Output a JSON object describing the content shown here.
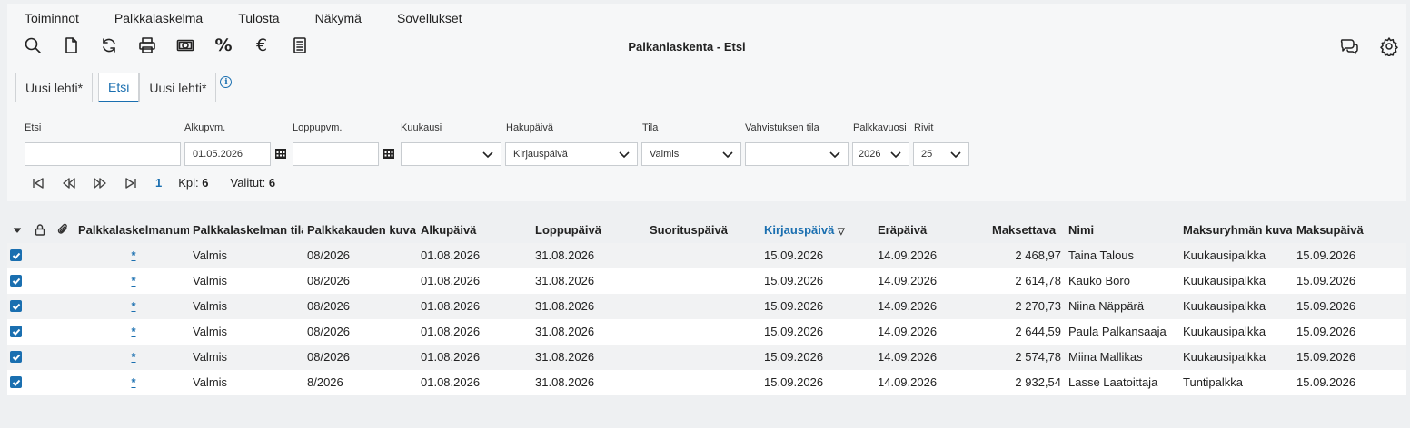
{
  "menu": [
    "Toiminnot",
    "Palkkalaskelma",
    "Tulosta",
    "Näkymä",
    "Sovellukset"
  ],
  "toolbar_icons": [
    "search-icon",
    "new-document-icon",
    "refresh-icon",
    "print-icon",
    "money-icon",
    "percent-icon",
    "euro-icon",
    "report-icon"
  ],
  "title": "Palkanlaskenta - Etsi",
  "tabs": [
    "Uusi lehti*",
    "Etsi",
    "Uusi lehti*"
  ],
  "active_tab": 1,
  "filters": {
    "etsi": {
      "label": "Etsi",
      "value": ""
    },
    "alkupvm": {
      "label": "Alkupvm.",
      "value": "01.05.2026"
    },
    "loppupvm": {
      "label": "Loppupvm.",
      "value": ""
    },
    "kuukausi": {
      "label": "Kuukausi",
      "value": ""
    },
    "hakupaiva": {
      "label": "Hakupäivä",
      "value": "Kirjauspäivä"
    },
    "tila": {
      "label": "Tila",
      "value": "Valmis"
    },
    "vahvistuksen_tila": {
      "label": "Vahvistuksen tila",
      "value": ""
    },
    "palkkavuosi": {
      "label": "Palkkavuosi",
      "value": "2026"
    },
    "rivit": {
      "label": "Rivit",
      "value": "25"
    }
  },
  "pager": {
    "page": "1",
    "kpl_label": "Kpl:",
    "kpl": "6",
    "valitut_label": "Valitut:",
    "valitut": "6"
  },
  "columns": [
    "Palkkalaskelmanumero",
    "Palkkalaskelman tila",
    "Palkkakauden kuvaus",
    "Alkupäivä",
    "Loppupäivä",
    "Suorituspäivä",
    "Kirjauspäivä",
    "Eräpäivä",
    "Maksettava",
    "Nimi",
    "Maksuryhmän kuvaus",
    "Maksupäivä"
  ],
  "sorted_column": "Kirjauspäivä",
  "rows": [
    {
      "nro": "*",
      "tila": "Valmis",
      "kausi": "08/2026",
      "alku": "01.08.2026",
      "loppu": "31.08.2026",
      "suoritus": "",
      "kirjaus": "15.09.2026",
      "era": "14.09.2026",
      "maksettava": "2 468,97",
      "nimi": "Taina Talous",
      "ryhma": "Kuukausipalkka",
      "maksu": "15.09.2026"
    },
    {
      "nro": "*",
      "tila": "Valmis",
      "kausi": "08/2026",
      "alku": "01.08.2026",
      "loppu": "31.08.2026",
      "suoritus": "",
      "kirjaus": "15.09.2026",
      "era": "14.09.2026",
      "maksettava": "2 614,78",
      "nimi": "Kauko Boro",
      "ryhma": "Kuukausipalkka",
      "maksu": "15.09.2026"
    },
    {
      "nro": "*",
      "tila": "Valmis",
      "kausi": "08/2026",
      "alku": "01.08.2026",
      "loppu": "31.08.2026",
      "suoritus": "",
      "kirjaus": "15.09.2026",
      "era": "14.09.2026",
      "maksettava": "2 270,73",
      "nimi": "Niina Näppärä",
      "ryhma": "Kuukausipalkka",
      "maksu": "15.09.2026"
    },
    {
      "nro": "*",
      "tila": "Valmis",
      "kausi": "08/2026",
      "alku": "01.08.2026",
      "loppu": "31.08.2026",
      "suoritus": "",
      "kirjaus": "15.09.2026",
      "era": "14.09.2026",
      "maksettava": "2 644,59",
      "nimi": "Paula Palkansaaja",
      "ryhma": "Kuukausipalkka",
      "maksu": "15.09.2026"
    },
    {
      "nro": "*",
      "tila": "Valmis",
      "kausi": "08/2026",
      "alku": "01.08.2026",
      "loppu": "31.08.2026",
      "suoritus": "",
      "kirjaus": "15.09.2026",
      "era": "14.09.2026",
      "maksettava": "2 574,78",
      "nimi": "Miina Mallikas",
      "ryhma": "Kuukausipalkka",
      "maksu": "15.09.2026"
    },
    {
      "nro": "*",
      "tila": "Valmis",
      "kausi": "8/2026",
      "alku": "01.08.2026",
      "loppu": "31.08.2026",
      "suoritus": "",
      "kirjaus": "15.09.2026",
      "era": "14.09.2026",
      "maksettava": "2 932,54",
      "nimi": "Lasse Laatoittaja",
      "ryhma": "Tuntipalkka",
      "maksu": "15.09.2026"
    }
  ],
  "accent_color": "#1a6fb0"
}
